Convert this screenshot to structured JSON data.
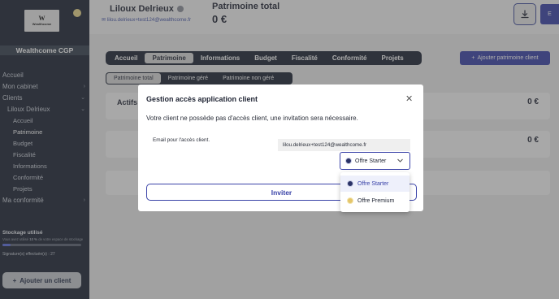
{
  "sidebar": {
    "logo_mark": "W",
    "logo_word": "Wealthcome",
    "brand": "Wealthcome CGP",
    "nav": [
      {
        "label": "Accueil"
      },
      {
        "label": "Mon cabinet"
      },
      {
        "label": "Clients"
      },
      {
        "label": "Liloux Delrieux"
      },
      {
        "label": "Accueil"
      },
      {
        "label": "Patrimoine"
      },
      {
        "label": "Budget"
      },
      {
        "label": "Fiscalité"
      },
      {
        "label": "Informations"
      },
      {
        "label": "Conformité"
      },
      {
        "label": "Projets"
      },
      {
        "label": "Ma conformité"
      }
    ],
    "storage": {
      "title": "Stockage utilisé",
      "sub_prefix": "Vous avez utilisé ",
      "sub_percent": "10 %",
      "sub_suffix": " de votre espace de stockage",
      "used_fraction": 0.1,
      "signatures_label": "Signature(s) effectuée(s) :",
      "signatures_count": "27"
    },
    "add_client": "Ajouter un client"
  },
  "header": {
    "client_name": "Liloux Delrieux",
    "client_email": "lilou.delrieux+test124@wealthcome.fr",
    "patrimoine_label": "Patrimoine total",
    "patrimoine_value": "0 €",
    "user_initial": "E"
  },
  "tabs": [
    "Accueil",
    "Patrimoine",
    "Informations",
    "Budget",
    "Fiscalité",
    "Conformité",
    "Projets"
  ],
  "active_tab": "Patrimoine",
  "add_patrimoine": "Ajouter patrimoine client",
  "subtabs": [
    "Patrimoine total",
    "Patrimoine géré",
    "Patrimoine non géré"
  ],
  "cards": [
    {
      "label": "Actifs",
      "amount": "0 €"
    },
    {
      "label": "",
      "amount": "0 €"
    }
  ],
  "modal": {
    "title": "Gestion accès application client",
    "description": "Votre client ne possède pas d'accès client, une invitation sera nécessaire.",
    "email_label": "Email pour l'accès client.",
    "email_value": "lilou.delrieux+test124@wealthcome.fr",
    "selected_offer": "Offre Starter",
    "invite": "Inviter",
    "offer_options": [
      "Offre Starter",
      "Offre Premium"
    ]
  },
  "colors": {
    "sidebar_bg": "#1c2433",
    "accent": "#3a43a8",
    "premium_badge": "#e4c66a",
    "starter_badge": "#2a3266"
  }
}
